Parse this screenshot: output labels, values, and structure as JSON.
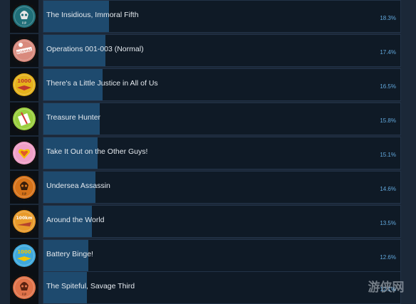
{
  "achievements": [
    {
      "name": "The Insidious, Immoral Fifth",
      "percent": "18.3%",
      "ratio": 0.183,
      "badge": "cap-skull-rip-icon",
      "cap_color": "#1f6f78",
      "accent": "#e6e6e6"
    },
    {
      "name": "Operations 001-003 (Normal)",
      "percent": "17.4%",
      "ratio": 0.174,
      "badge": "cap-normal-icon",
      "cap_color": "#d98a7d",
      "accent": "#ffffff"
    },
    {
      "name": "There's a Little Justice in All of Us",
      "percent": "16.5%",
      "ratio": 0.165,
      "badge": "cap-1000-icon",
      "cap_color": "#e5b21c",
      "accent": "#c0392b"
    },
    {
      "name": "Treasure Hunter",
      "percent": "15.8%",
      "ratio": 0.158,
      "badge": "cap-treasure-icon",
      "cap_color": "#9bcf3f",
      "accent": "#e6e6e6"
    },
    {
      "name": "Take It Out on the Other Guys!",
      "percent": "15.1%",
      "ratio": 0.151,
      "badge": "cap-hearts-icon",
      "cap_color": "#f0a0c8",
      "accent": "#f2c300"
    },
    {
      "name": "Undersea Assassin",
      "percent": "14.6%",
      "ratio": 0.146,
      "badge": "cap-skull-rip-icon",
      "cap_color": "#d6731a",
      "accent": "#3a1e0b"
    },
    {
      "name": "Around the World",
      "percent": "13.5%",
      "ratio": 0.135,
      "badge": "cap-100km-icon",
      "cap_color": "#e89a2a",
      "accent": "#b5432d"
    },
    {
      "name": "Battery Binge!",
      "percent": "12.6%",
      "ratio": 0.126,
      "badge": "cap-1000-icon",
      "cap_color": "#3fa9dc",
      "accent": "#f2c300"
    },
    {
      "name": "The Spiteful, Savage Third",
      "percent": "12.1%",
      "ratio": 0.121,
      "badge": "cap-skull-rip-icon",
      "cap_color": "#e0734a",
      "accent": "#5a2210"
    }
  ],
  "watermark": {
    "text": "游侠网"
  }
}
